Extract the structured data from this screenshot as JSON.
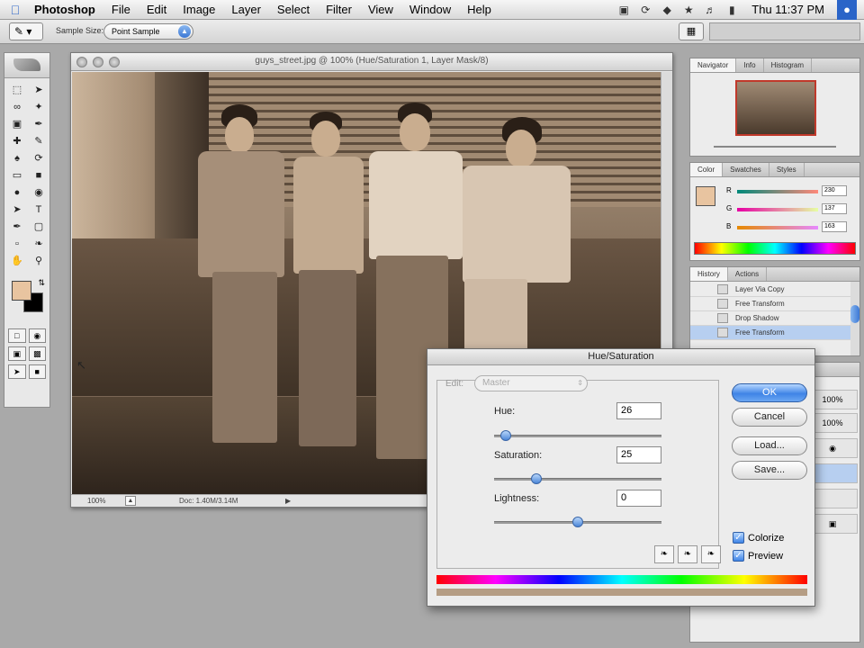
{
  "menubar": {
    "app": "Photoshop",
    "items": [
      "File",
      "Edit",
      "Image",
      "Layer",
      "Select",
      "Filter",
      "View",
      "Window",
      "Help"
    ],
    "clock": "Thu 11:37 PM"
  },
  "options": {
    "sample_size_label": "Sample Size:",
    "sample_size_value": "Point Sample"
  },
  "document": {
    "title": "guys_street.jpg @ 100% (Hue/Saturation 1, Layer Mask/8)",
    "zoom": "100%",
    "doc_info": "Doc: 1.40M/3.14M"
  },
  "palettes": {
    "navigator_tabs": [
      "Navigator",
      "Info",
      "Histogram"
    ],
    "color_tabs": [
      "Color",
      "Swatches",
      "Styles"
    ],
    "color_rows": [
      {
        "label": "R",
        "value": "230"
      },
      {
        "label": "G",
        "value": "137"
      },
      {
        "label": "B",
        "value": "163"
      }
    ],
    "history_tabs": [
      "History",
      "Actions"
    ],
    "history_items": [
      "Layer Via Copy",
      "Free Transform",
      "Drop Shadow",
      "Free Transform"
    ],
    "layers_values": [
      "100%",
      "100%"
    ]
  },
  "hue_dialog": {
    "title": "Hue/Saturation",
    "edit_label": "Edit:",
    "edit_value": "Master",
    "hue_label": "Hue:",
    "hue_value": "26",
    "saturation_label": "Saturation:",
    "saturation_value": "25",
    "lightness_label": "Lightness:",
    "lightness_value": "0",
    "hue_level": 26,
    "saturation_level": 25,
    "lightness_level": 0,
    "ok": "OK",
    "cancel": "Cancel",
    "load": "Load...",
    "save": "Save...",
    "colorize_label": "Colorize",
    "colorize_checked": true,
    "preview_label": "Preview",
    "preview_checked": true
  },
  "colors": {
    "foreground": "#e8c4a0",
    "background": "#000000",
    "accent": "#3f84e6"
  }
}
